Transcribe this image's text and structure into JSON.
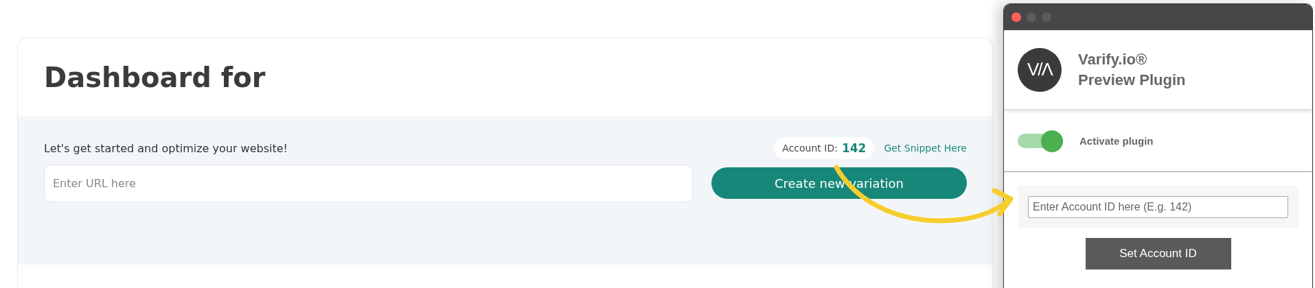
{
  "dashboard": {
    "title": "Dashboard for",
    "intro": "Let's get started and optimize your website!",
    "url_field": {
      "placeholder": "Enter URL here"
    },
    "account_label": "Account ID:",
    "account_id": "142",
    "snippet_link": "Get Snippet Here",
    "create_button": "Create new variation"
  },
  "plugin": {
    "window_controls": [
      {
        "color": "#fe5f57"
      },
      {
        "color": "#5c5c5c"
      },
      {
        "color": "#5c5c5c"
      }
    ],
    "logo": "V/Λ",
    "title_lines": [
      "Varify.io®",
      "Preview Plugin"
    ],
    "toggle": {
      "label": "Activate plugin",
      "on": true
    },
    "account_field": {
      "placeholder": "Enter Account ID here (E.g. 142)"
    },
    "set_button": "Set Account ID"
  }
}
